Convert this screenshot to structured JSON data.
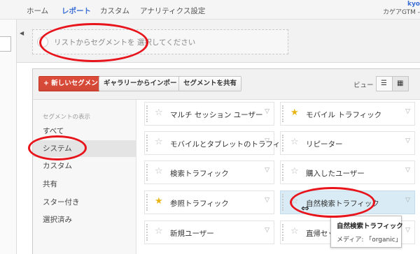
{
  "topnav": {
    "tabs": [
      "ホーム",
      "レポート",
      "カスタム",
      "アナリティクス設定"
    ],
    "user": "kyo",
    "account": "カゲアGTM -"
  },
  "segment_bar": {
    "placeholder": "リストからセグメントを 選択してください"
  },
  "toolbar": {
    "new_segment": "+ 新しいセグメント",
    "import_gallery": "ギャラリーからインポート",
    "share_segment": "セグメントを共有",
    "view_label": "ビュー"
  },
  "sidebar": {
    "header": "セグメントの表示",
    "items": [
      "すべて",
      "システム",
      "カスタム",
      "共有",
      "スター付き",
      "選択済み"
    ],
    "selected": "システム"
  },
  "segments": {
    "left": [
      {
        "label": "マルチ セッション ユーザー",
        "starred": false
      },
      {
        "label": "モバイルとタブレットのトラフィック",
        "starred": false
      },
      {
        "label": "検索トラフィック",
        "starred": false
      },
      {
        "label": "参照トラフィック",
        "starred": true
      },
      {
        "label": "新規ユーザー",
        "starred": false
      }
    ],
    "right": [
      {
        "label": "モバイル トラフィック",
        "starred": true
      },
      {
        "label": "リピーター",
        "starred": false
      },
      {
        "label": "購入したユーザー",
        "starred": false
      },
      {
        "label": "自然検索トラフィック",
        "starred": false,
        "highlighted": true
      },
      {
        "label": "直帰セッ",
        "starred": false
      }
    ]
  },
  "tooltip": {
    "title": "自然検索トラフィック",
    "detail": "メディア: 「organic」"
  },
  "icons": {
    "star": "star-icon",
    "dropdown": "chevron-down-icon",
    "list_view": "list-view-icon",
    "grid_view": "grid-view-icon",
    "move": "move-cursor-icon"
  },
  "colors": {
    "accent": "#3b6fd6",
    "primary_button": "#d14836",
    "annotation": "#e8141c",
    "star_on": "#e8b514",
    "highlight": "#d9ecf5"
  }
}
